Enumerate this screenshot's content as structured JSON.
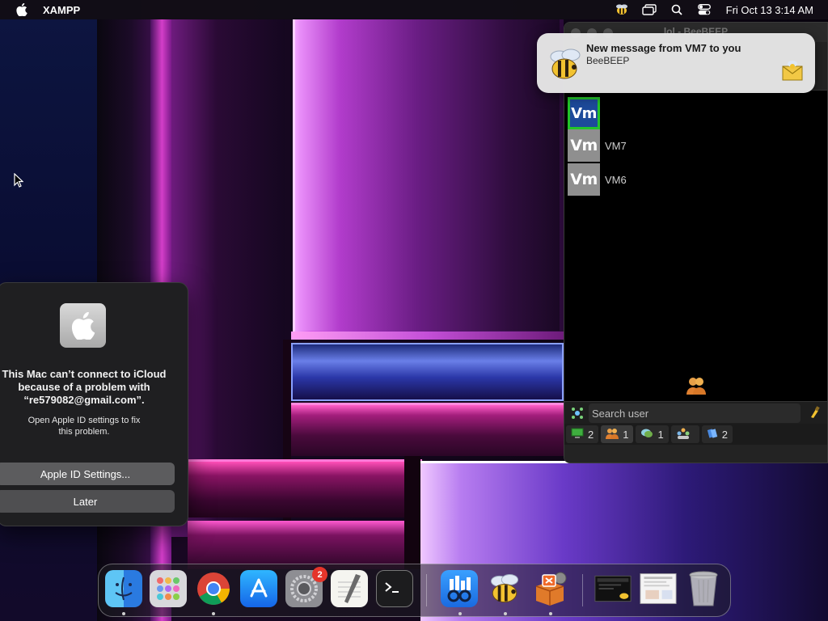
{
  "menubar": {
    "app_name": "XAMPP",
    "clock": "Fri Oct 13  3:14 AM",
    "icons": [
      "apple-icon",
      "beebeep-icon",
      "window-icon",
      "search-icon",
      "control-center-icon"
    ]
  },
  "beebeep_window": {
    "title": "lol - BeeBEEP",
    "users": [
      {
        "avatar": "Vm",
        "name": "",
        "is_self": true
      },
      {
        "avatar": "Vm",
        "name": "VM7",
        "is_self": false
      },
      {
        "avatar": "Vm",
        "name": "VM6",
        "is_self": false
      }
    ],
    "search": {
      "placeholder": "Search user",
      "value": ""
    },
    "status_tabs": [
      {
        "icon": "computer-icon",
        "count": "2"
      },
      {
        "icon": "users-icon",
        "count": "1"
      },
      {
        "icon": "chat-icon",
        "count": "1"
      },
      {
        "icon": "group-icon",
        "count": ""
      },
      {
        "icon": "file-icon",
        "count": "2"
      }
    ]
  },
  "notification": {
    "title": "New message from VM7 to you",
    "body": "BeeBEEP"
  },
  "icloud_dialog": {
    "heading_line1": "This Mac can’t connect to iCloud",
    "heading_line2": "because of a problem with",
    "heading_line3": "“re579082@gmail.com”.",
    "text_line1": "Open Apple ID settings to fix",
    "text_line2": "this problem.",
    "primary_button": "Apple ID Settings...",
    "secondary_button": "Later"
  },
  "dock": {
    "items": [
      {
        "name": "finder",
        "running": true
      },
      {
        "name": "launchpad",
        "running": false
      },
      {
        "name": "chrome",
        "running": true
      },
      {
        "name": "app-store",
        "running": false
      },
      {
        "name": "system-settings",
        "running": false,
        "badge": "2"
      },
      {
        "name": "textedit",
        "running": false
      },
      {
        "name": "terminal",
        "running": false
      },
      {
        "name": "glances",
        "running": true
      },
      {
        "name": "beebeep",
        "running": true
      },
      {
        "name": "xampp",
        "running": true
      },
      {
        "name": "screenshot-thumbnail",
        "running": false
      },
      {
        "name": "document-thumbnail",
        "running": false
      },
      {
        "name": "trash",
        "running": false
      }
    ]
  },
  "colors": {
    "menubar_bg": "#120e16",
    "dialog_bg": "#1f1f21",
    "badge_red": "#e5352b",
    "self_avatar_border": "#23c42a",
    "avatar_gray": "#8f8f8f"
  }
}
